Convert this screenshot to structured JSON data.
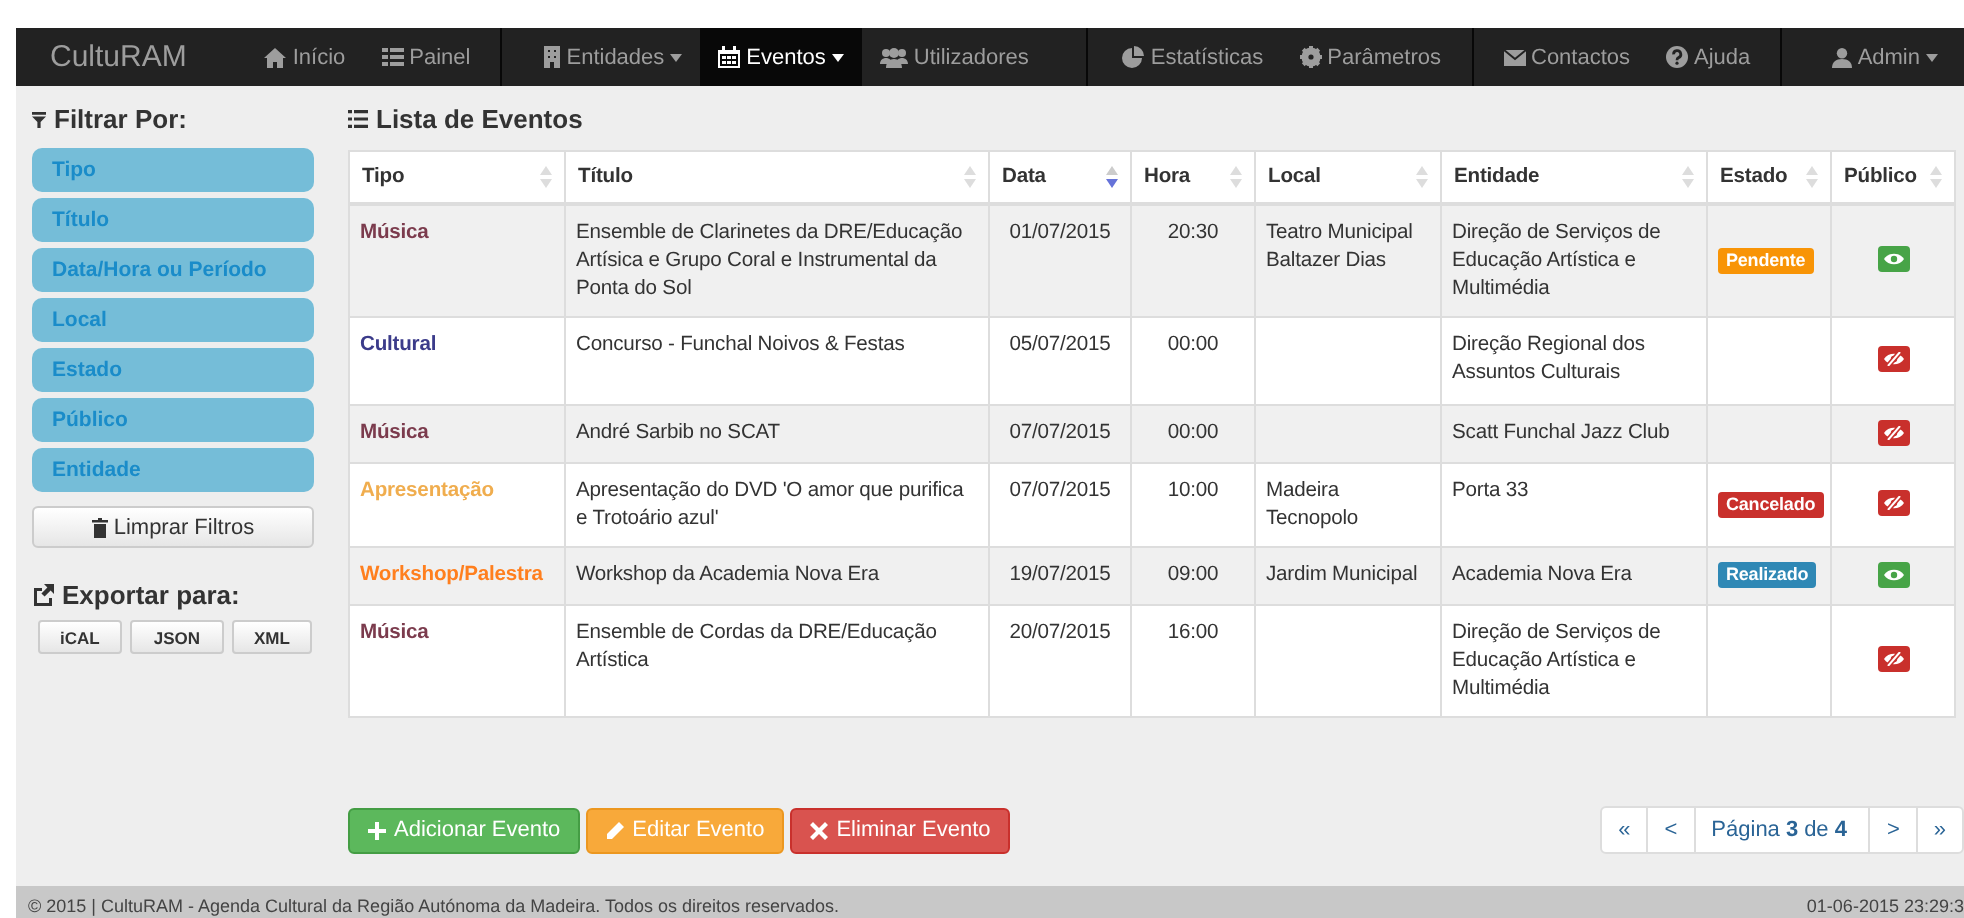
{
  "navbar": {
    "brand": "CultuRAM",
    "groups": [
      [
        {
          "label": "Início",
          "selected": false,
          "dropdown": false
        },
        {
          "label": "Painel",
          "selected": false,
          "dropdown": false
        }
      ],
      [
        {
          "label": "Entidades",
          "selected": false,
          "dropdown": true
        },
        {
          "label": "Eventos",
          "selected": true,
          "dropdown": true
        },
        {
          "label": "Utilizadores",
          "selected": false,
          "dropdown": false
        }
      ],
      [
        {
          "label": "Estatísticas",
          "selected": false,
          "dropdown": false
        },
        {
          "label": "Parâmetros",
          "selected": false,
          "dropdown": false
        }
      ],
      [
        {
          "label": "Contactos",
          "selected": false,
          "dropdown": false
        },
        {
          "label": "Ajuda",
          "selected": false,
          "dropdown": false
        }
      ]
    ],
    "user_menu": {
      "label": "Admin",
      "dropdown": true
    }
  },
  "sidebar": {
    "title": "Filtrar Por:",
    "filters": [
      "Tipo",
      "Título",
      "Data/Hora ou Período",
      "Local",
      "Estado",
      "Público",
      "Entidade"
    ],
    "clear_button": "Limprar Filtros",
    "export_title": "Exportar para:",
    "export_buttons": [
      "iCAL",
      "JSON",
      "XML"
    ]
  },
  "list_title": "Lista de Eventos",
  "table": {
    "columns": [
      {
        "label": "Tipo",
        "sorted": false
      },
      {
        "label": "Título",
        "sorted": false
      },
      {
        "label": "Data",
        "sorted": true
      },
      {
        "label": "Hora",
        "sorted": false
      },
      {
        "label": "Local",
        "sorted": false
      },
      {
        "label": "Entidade",
        "sorted": false
      },
      {
        "label": "Estado",
        "sorted": false
      },
      {
        "label": "Público",
        "sorted": false
      }
    ],
    "rows": [
      {
        "tipo": {
          "label": "Música",
          "color": "#7b3b4d"
        },
        "titulo": "Ensemble de Clarinetes da DRE/Educação Artísica e Grupo Coral e Instrumental da Ponta do Sol",
        "data": "01/07/2015",
        "hora": "20:30",
        "local": "Teatro Municipal Baltazer Dias",
        "entidade": "Direção de Serviços de Educação Artística e Multimédia",
        "estado": {
          "label": "Pendente",
          "kind": "warning"
        },
        "public": true
      },
      {
        "tipo": {
          "label": "Cultural",
          "color": "#3b3b8a"
        },
        "titulo": "Concurso - Funchal Noivos & Festas",
        "data": "05/07/2015",
        "hora": "00:00",
        "entidade": "Direção Regional dos Assuntos Culturais",
        "public": false
      },
      {
        "tipo": {
          "label": "Música",
          "color": "#7b3b4d"
        },
        "titulo": "André Sarbib no SCAT",
        "data": "07/07/2015",
        "hora": "00:00",
        "entidade": "Scatt Funchal Jazz Club",
        "public": false
      },
      {
        "tipo": {
          "label": "Apresentação",
          "color": "#f0ad4e"
        },
        "titulo": "Apresentação do DVD 'O amor que purifica e Trotoário azul'",
        "data": "07/07/2015",
        "hora": "10:00",
        "local": "Madeira Tecnopolo",
        "entidade": "Porta 33",
        "estado": {
          "label": "Cancelado",
          "kind": "danger"
        },
        "public": false
      },
      {
        "tipo": {
          "label": "Workshop/Palestra",
          "color": "#ff7f1e"
        },
        "titulo": "Workshop da Academia Nova Era",
        "data": "19/07/2015",
        "hora": "09:00",
        "local": "Jardim Municipal",
        "entidade": "Academia Nova Era",
        "estado": {
          "label": "Realizado",
          "kind": "info"
        },
        "public": true
      },
      {
        "tipo": {
          "label": "Música",
          "color": "#7b3b4d"
        },
        "titulo": "Ensemble de Cordas da DRE/Educação Artística",
        "data": "20/07/2015",
        "hora": "16:00",
        "entidade": "Direção de Serviços de Educação Artística e Multimédia",
        "public": false
      }
    ]
  },
  "actions": [
    {
      "label": "Adicionar Evento",
      "kind": "add"
    },
    {
      "label": "Editar Evento",
      "kind": "edit"
    },
    {
      "label": "Eliminar Evento",
      "kind": "delete"
    }
  ],
  "pagination": {
    "first": "«",
    "prev": "<",
    "page": "Página **3** de **4**",
    "next": ">",
    "last": "»"
  },
  "footer": {
    "text": "© 2015 | CultuRAM - Agenda Cultural da Região Autónoma da Madeira. Todos os direitos reservados.",
    "timestamp": "01-06-2015 23:29:3"
  }
}
